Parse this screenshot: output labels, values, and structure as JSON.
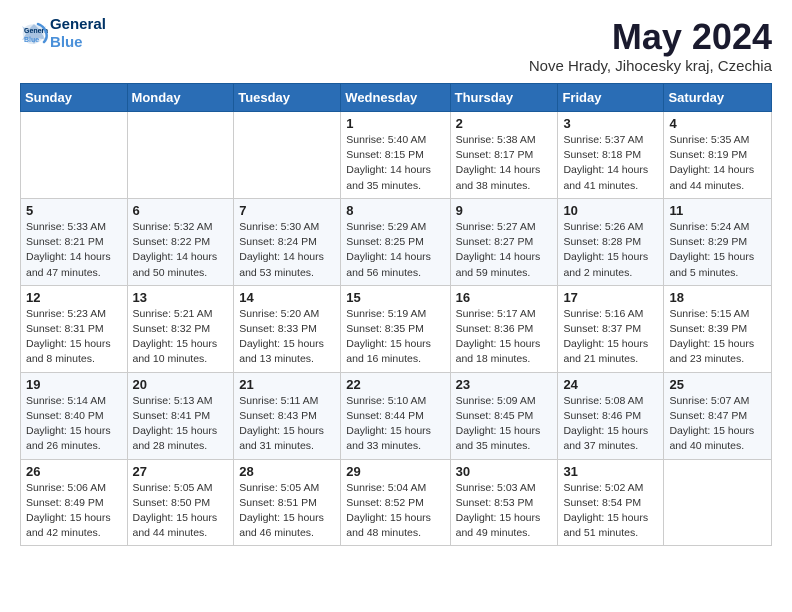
{
  "header": {
    "logo_line1": "General",
    "logo_line2": "Blue",
    "month_title": "May 2024",
    "location": "Nove Hrady, Jihocesky kraj, Czechia"
  },
  "weekdays": [
    "Sunday",
    "Monday",
    "Tuesday",
    "Wednesday",
    "Thursday",
    "Friday",
    "Saturday"
  ],
  "weeks": [
    [
      {
        "day": "",
        "info": ""
      },
      {
        "day": "",
        "info": ""
      },
      {
        "day": "",
        "info": ""
      },
      {
        "day": "1",
        "info": "Sunrise: 5:40 AM\nSunset: 8:15 PM\nDaylight: 14 hours\nand 35 minutes."
      },
      {
        "day": "2",
        "info": "Sunrise: 5:38 AM\nSunset: 8:17 PM\nDaylight: 14 hours\nand 38 minutes."
      },
      {
        "day": "3",
        "info": "Sunrise: 5:37 AM\nSunset: 8:18 PM\nDaylight: 14 hours\nand 41 minutes."
      },
      {
        "day": "4",
        "info": "Sunrise: 5:35 AM\nSunset: 8:19 PM\nDaylight: 14 hours\nand 44 minutes."
      }
    ],
    [
      {
        "day": "5",
        "info": "Sunrise: 5:33 AM\nSunset: 8:21 PM\nDaylight: 14 hours\nand 47 minutes."
      },
      {
        "day": "6",
        "info": "Sunrise: 5:32 AM\nSunset: 8:22 PM\nDaylight: 14 hours\nand 50 minutes."
      },
      {
        "day": "7",
        "info": "Sunrise: 5:30 AM\nSunset: 8:24 PM\nDaylight: 14 hours\nand 53 minutes."
      },
      {
        "day": "8",
        "info": "Sunrise: 5:29 AM\nSunset: 8:25 PM\nDaylight: 14 hours\nand 56 minutes."
      },
      {
        "day": "9",
        "info": "Sunrise: 5:27 AM\nSunset: 8:27 PM\nDaylight: 14 hours\nand 59 minutes."
      },
      {
        "day": "10",
        "info": "Sunrise: 5:26 AM\nSunset: 8:28 PM\nDaylight: 15 hours\nand 2 minutes."
      },
      {
        "day": "11",
        "info": "Sunrise: 5:24 AM\nSunset: 8:29 PM\nDaylight: 15 hours\nand 5 minutes."
      }
    ],
    [
      {
        "day": "12",
        "info": "Sunrise: 5:23 AM\nSunset: 8:31 PM\nDaylight: 15 hours\nand 8 minutes."
      },
      {
        "day": "13",
        "info": "Sunrise: 5:21 AM\nSunset: 8:32 PM\nDaylight: 15 hours\nand 10 minutes."
      },
      {
        "day": "14",
        "info": "Sunrise: 5:20 AM\nSunset: 8:33 PM\nDaylight: 15 hours\nand 13 minutes."
      },
      {
        "day": "15",
        "info": "Sunrise: 5:19 AM\nSunset: 8:35 PM\nDaylight: 15 hours\nand 16 minutes."
      },
      {
        "day": "16",
        "info": "Sunrise: 5:17 AM\nSunset: 8:36 PM\nDaylight: 15 hours\nand 18 minutes."
      },
      {
        "day": "17",
        "info": "Sunrise: 5:16 AM\nSunset: 8:37 PM\nDaylight: 15 hours\nand 21 minutes."
      },
      {
        "day": "18",
        "info": "Sunrise: 5:15 AM\nSunset: 8:39 PM\nDaylight: 15 hours\nand 23 minutes."
      }
    ],
    [
      {
        "day": "19",
        "info": "Sunrise: 5:14 AM\nSunset: 8:40 PM\nDaylight: 15 hours\nand 26 minutes."
      },
      {
        "day": "20",
        "info": "Sunrise: 5:13 AM\nSunset: 8:41 PM\nDaylight: 15 hours\nand 28 minutes."
      },
      {
        "day": "21",
        "info": "Sunrise: 5:11 AM\nSunset: 8:43 PM\nDaylight: 15 hours\nand 31 minutes."
      },
      {
        "day": "22",
        "info": "Sunrise: 5:10 AM\nSunset: 8:44 PM\nDaylight: 15 hours\nand 33 minutes."
      },
      {
        "day": "23",
        "info": "Sunrise: 5:09 AM\nSunset: 8:45 PM\nDaylight: 15 hours\nand 35 minutes."
      },
      {
        "day": "24",
        "info": "Sunrise: 5:08 AM\nSunset: 8:46 PM\nDaylight: 15 hours\nand 37 minutes."
      },
      {
        "day": "25",
        "info": "Sunrise: 5:07 AM\nSunset: 8:47 PM\nDaylight: 15 hours\nand 40 minutes."
      }
    ],
    [
      {
        "day": "26",
        "info": "Sunrise: 5:06 AM\nSunset: 8:49 PM\nDaylight: 15 hours\nand 42 minutes."
      },
      {
        "day": "27",
        "info": "Sunrise: 5:05 AM\nSunset: 8:50 PM\nDaylight: 15 hours\nand 44 minutes."
      },
      {
        "day": "28",
        "info": "Sunrise: 5:05 AM\nSunset: 8:51 PM\nDaylight: 15 hours\nand 46 minutes."
      },
      {
        "day": "29",
        "info": "Sunrise: 5:04 AM\nSunset: 8:52 PM\nDaylight: 15 hours\nand 48 minutes."
      },
      {
        "day": "30",
        "info": "Sunrise: 5:03 AM\nSunset: 8:53 PM\nDaylight: 15 hours\nand 49 minutes."
      },
      {
        "day": "31",
        "info": "Sunrise: 5:02 AM\nSunset: 8:54 PM\nDaylight: 15 hours\nand 51 minutes."
      },
      {
        "day": "",
        "info": ""
      }
    ]
  ]
}
